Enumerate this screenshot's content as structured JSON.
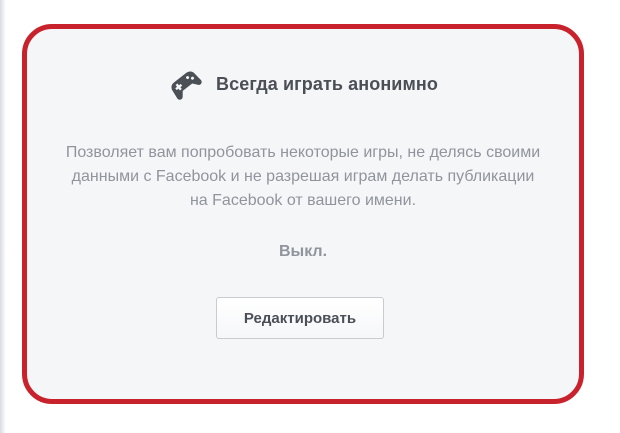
{
  "card": {
    "icon": "gamepad-icon",
    "title": "Всегда играть анонимно",
    "description": "Позволяет вам попробовать некоторые игры, не делясь своими данными с Facebook и не разрешая играм делать публикации на Facebook от вашего имени.",
    "status": "Выкл.",
    "edit_label": "Редактировать",
    "border_color": "#c8222c",
    "background_color": "#f5f6f7"
  }
}
